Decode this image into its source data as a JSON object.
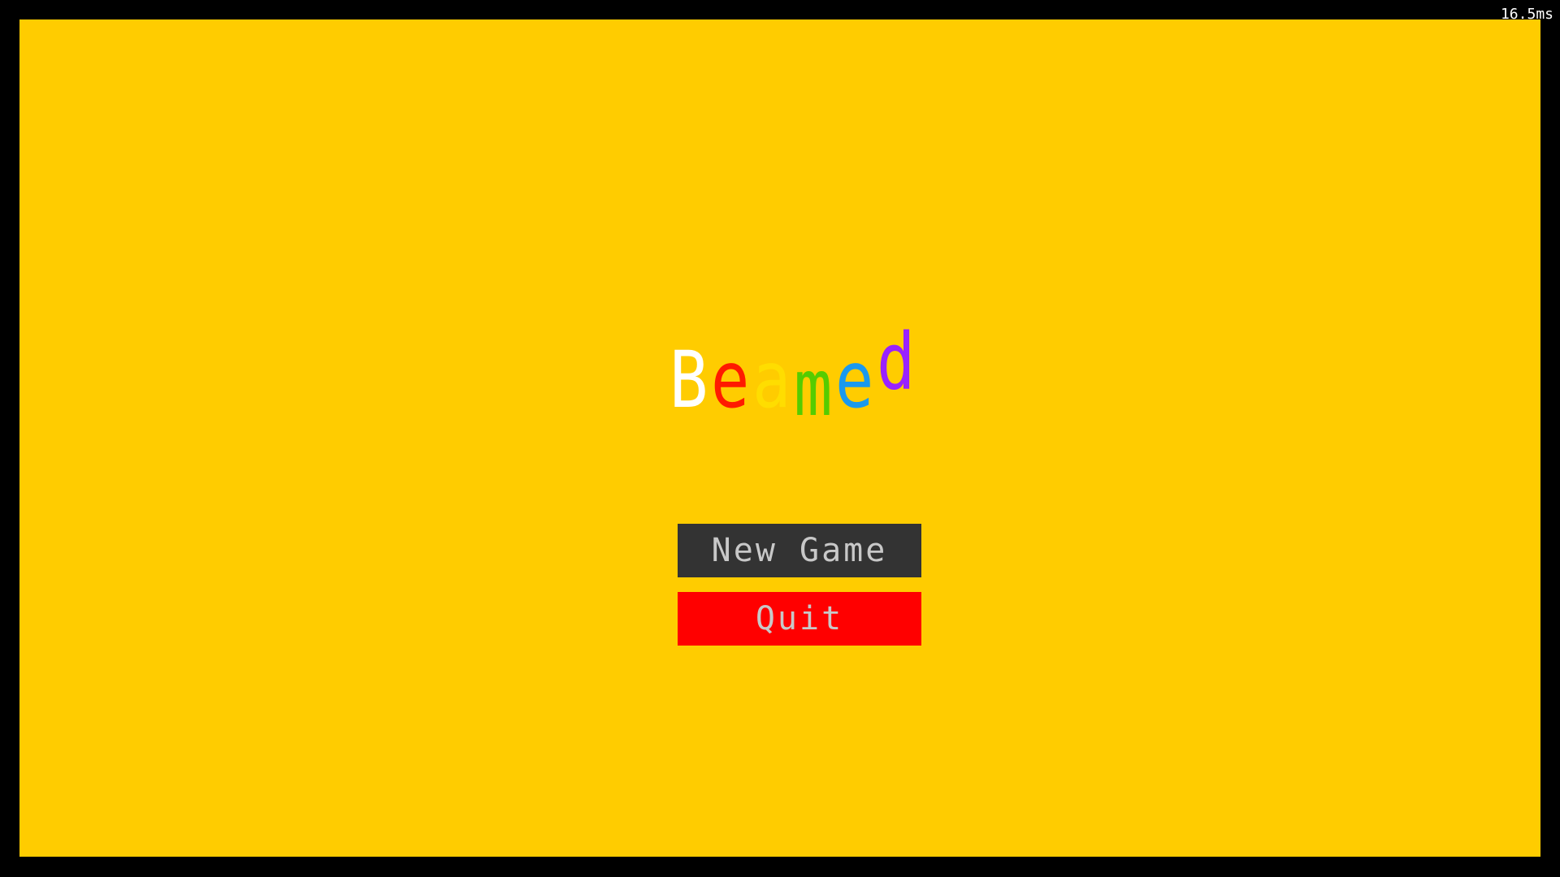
{
  "hud": {
    "frame_time": "16.5ms"
  },
  "title": {
    "letters": [
      {
        "char": "B",
        "color": "#ffffff"
      },
      {
        "char": "e",
        "color": "#ff1a00"
      },
      {
        "char": "a",
        "color": "#ffdd00"
      },
      {
        "char": "m",
        "color": "#55cc00"
      },
      {
        "char": "e",
        "color": "#1a99ee"
      },
      {
        "char": "d",
        "color": "#9922ff"
      }
    ]
  },
  "menu": {
    "new_game_label": "New Game",
    "quit_label": "Quit"
  },
  "colors": {
    "background": "#ffcc00",
    "border": "#000000",
    "new_game_button": "#333333",
    "quit_button": "#ff0000",
    "button_text": "#c8c8c8"
  }
}
